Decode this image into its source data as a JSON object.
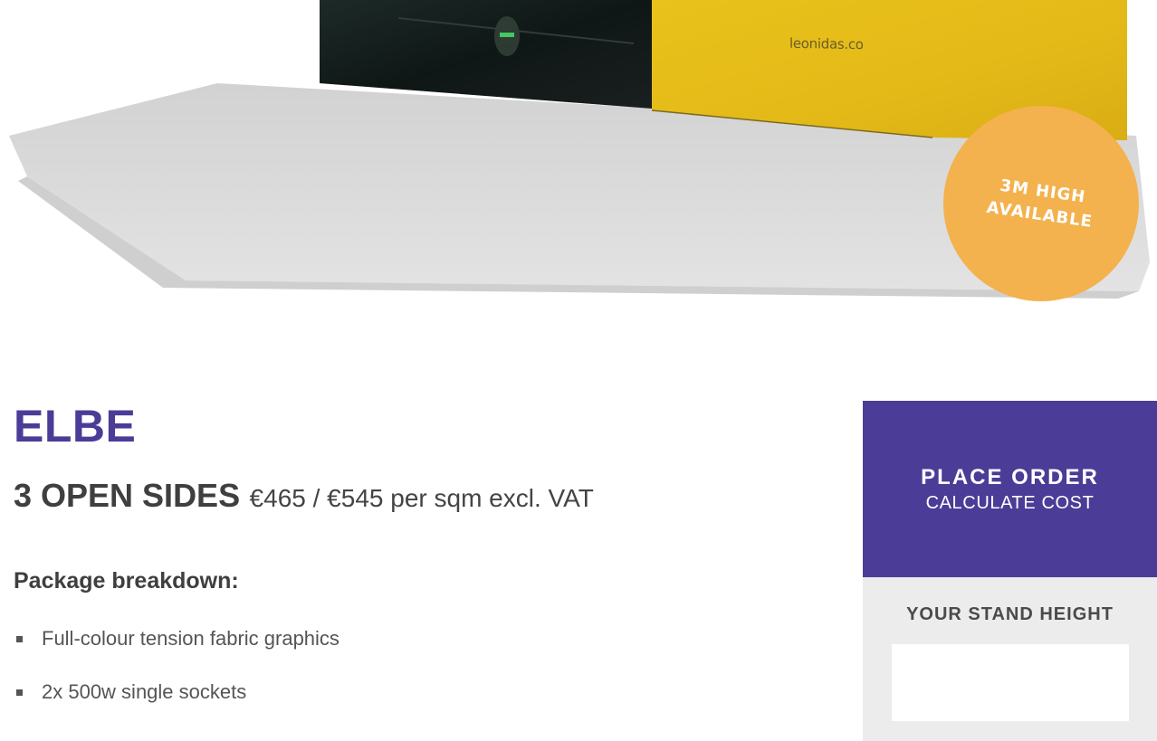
{
  "hero": {
    "image_alt": "Stand image",
    "brand_text": "leonidas.co",
    "badge_line1": "3M HIGH",
    "badge_line2": "AVAILABLE"
  },
  "product": {
    "title": "ELBE",
    "variant": "3 OPEN SIDES",
    "price": "€465 / €545 per sqm excl. VAT",
    "breakdown_heading": "Package breakdown:",
    "features": [
      "Full-colour tension fabric graphics",
      "2x 500w single sockets"
    ]
  },
  "order": {
    "place_order_label": "PLACE ORDER",
    "calculate_label": "CALCULATE COST"
  },
  "stand_height": {
    "label": "YOUR STAND HEIGHT",
    "value": ""
  },
  "colors": {
    "brand_purple": "#4b3c97",
    "badge_orange": "#f3b24e",
    "panel_grey": "#ececec"
  }
}
